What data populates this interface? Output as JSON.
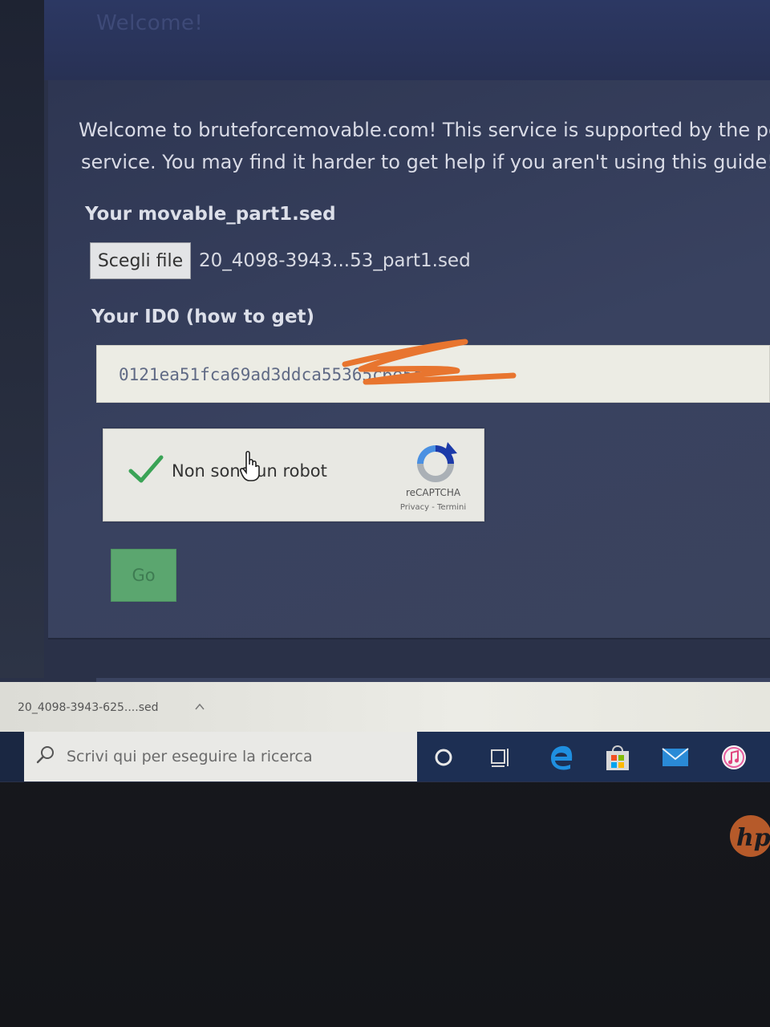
{
  "header": {
    "title": "Welcome!"
  },
  "intro": {
    "line1": "Welcome to bruteforcemovable.com! This service is supported by the peop",
    "line2": "service. You may find it harder to get help if you aren't using this guide! To u"
  },
  "movable_section": {
    "label": "Your movable_part1.sed",
    "choose_file_label": "Scegli file",
    "file_name": "20_4098-3943...53_part1.sed"
  },
  "id0_section": {
    "label": "Your ID0 (how to get)",
    "value": "0121ea51fca69ad3ddca55365c6e5e"
  },
  "recaptcha": {
    "label": "Non sono un robot",
    "brand": "reCAPTCHA",
    "links": "Privacy - Termini",
    "checked": true
  },
  "go_button": {
    "label": "Go"
  },
  "download_bar": {
    "file_name": "20_4098-3943-625....sed"
  },
  "taskbar": {
    "search_placeholder": "Scrivi qui per eseguire la ricerca",
    "icons": [
      "cortana-icon",
      "task-view-icon",
      "edge-icon",
      "store-icon",
      "mail-icon",
      "itunes-icon"
    ]
  },
  "colors": {
    "go_button": "#5ba66f",
    "check": "#3aa356",
    "scribble": "#e8752f",
    "taskbar": "#1d2f53"
  }
}
